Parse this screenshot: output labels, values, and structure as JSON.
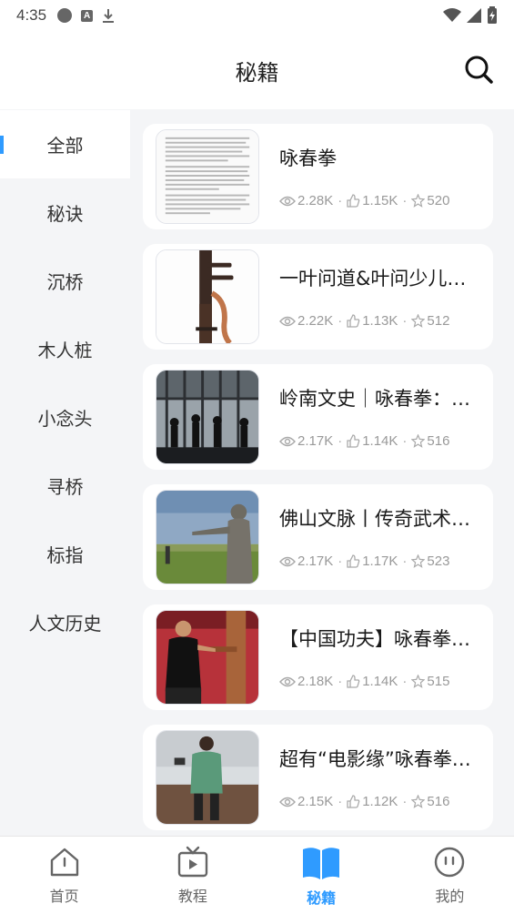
{
  "status_bar": {
    "time": "4:35"
  },
  "header": {
    "title": "秘籍"
  },
  "sidebar": {
    "items": [
      {
        "label": "全部",
        "active": true
      },
      {
        "label": "秘诀"
      },
      {
        "label": "沉桥"
      },
      {
        "label": "木人桩"
      },
      {
        "label": "小念头"
      },
      {
        "label": "寻桥"
      },
      {
        "label": "标指"
      },
      {
        "label": "人文历史"
      }
    ]
  },
  "articles": [
    {
      "title": "咏春拳",
      "views": "2.28K",
      "likes": "1.15K",
      "favorites": "520"
    },
    {
      "title": "一叶问道&叶问少儿…",
      "views": "2.22K",
      "likes": "1.13K",
      "favorites": "512"
    },
    {
      "title": "岭南文史｜咏春拳：…",
      "views": "2.17K",
      "likes": "1.14K",
      "favorites": "516"
    },
    {
      "title": "佛山文脉丨传奇武术…",
      "views": "2.17K",
      "likes": "1.17K",
      "favorites": "523"
    },
    {
      "title": "【中国功夫】咏春拳…",
      "views": "2.18K",
      "likes": "1.14K",
      "favorites": "515"
    },
    {
      "title": "超有“电影缘”咏春拳…",
      "views": "2.15K",
      "likes": "1.12K",
      "favorites": "516"
    }
  ],
  "bottom_nav": {
    "items": [
      {
        "label": "首页",
        "icon": "home-icon"
      },
      {
        "label": "教程",
        "icon": "video-icon"
      },
      {
        "label": "秘籍",
        "icon": "book-icon",
        "active": true
      },
      {
        "label": "我的",
        "icon": "profile-icon"
      }
    ]
  },
  "colors": {
    "accent": "#2f9bff",
    "background": "#f4f5f7"
  }
}
